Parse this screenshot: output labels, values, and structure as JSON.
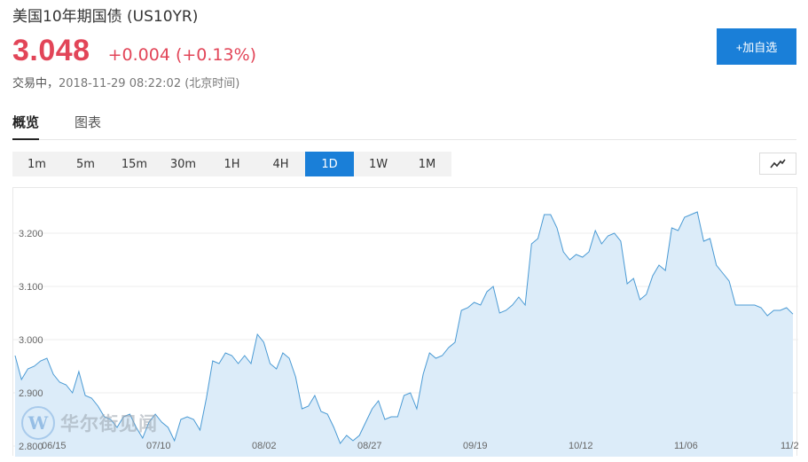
{
  "header": {
    "title": "美国10年期国债  (US10YR)",
    "price": "3.048",
    "change": "+0.004 (+0.13%)",
    "status": "交易中，",
    "timestamp": "2018-11-29 08:22:02 (北京时间)",
    "add_button": "+加自选"
  },
  "tabs": [
    {
      "label": "概览",
      "active": true
    },
    {
      "label": "图表",
      "active": false
    }
  ],
  "periods": [
    "1m",
    "5m",
    "15m",
    "30m",
    "1H",
    "4H",
    "1D",
    "1W",
    "1M"
  ],
  "active_period": "1D",
  "watermark": {
    "text": "华尔街见闻",
    "logo_letter": "W"
  },
  "colors": {
    "accent": "#1a7fd8",
    "price_up": "#e24558",
    "line": "#4a9ad4",
    "area": "#dcecf9"
  },
  "chart_data": {
    "type": "area",
    "x_tick_labels": [
      "06/15",
      "07/10",
      "08/02",
      "08/27",
      "09/19",
      "10/12",
      "11/06",
      "11/2"
    ],
    "y_tick_labels": [
      "3.200",
      "3.100",
      "3.000",
      "2.900",
      "2.800"
    ],
    "y_ticks": [
      3.2,
      3.1,
      3.0,
      2.9,
      2.8
    ],
    "ylim": [
      2.78,
      3.285
    ],
    "grid": true,
    "values": [
      2.97,
      2.925,
      2.945,
      2.95,
      2.96,
      2.965,
      2.935,
      2.92,
      2.915,
      2.9,
      2.94,
      2.895,
      2.89,
      2.875,
      2.855,
      2.85,
      2.835,
      2.855,
      2.86,
      2.835,
      2.815,
      2.845,
      2.86,
      2.845,
      2.835,
      2.81,
      2.85,
      2.855,
      2.85,
      2.83,
      2.89,
      2.96,
      2.955,
      2.975,
      2.97,
      2.955,
      2.97,
      2.955,
      3.01,
      2.995,
      2.955,
      2.945,
      2.975,
      2.965,
      2.93,
      2.87,
      2.875,
      2.895,
      2.865,
      2.86,
      2.835,
      2.805,
      2.82,
      2.81,
      2.82,
      2.845,
      2.87,
      2.885,
      2.85,
      2.855,
      2.855,
      2.895,
      2.9,
      2.87,
      2.935,
      2.975,
      2.965,
      2.97,
      2.985,
      2.995,
      3.055,
      3.06,
      3.07,
      3.065,
      3.09,
      3.1,
      3.05,
      3.055,
      3.065,
      3.08,
      3.065,
      3.18,
      3.19,
      3.235,
      3.235,
      3.21,
      3.165,
      3.15,
      3.16,
      3.155,
      3.165,
      3.205,
      3.18,
      3.195,
      3.2,
      3.185,
      3.105,
      3.115,
      3.075,
      3.085,
      3.12,
      3.14,
      3.13,
      3.21,
      3.205,
      3.23,
      3.235,
      3.24,
      3.185,
      3.19,
      3.14,
      3.125,
      3.11,
      3.065,
      3.065,
      3.065,
      3.065,
      3.06,
      3.045,
      3.055,
      3.055,
      3.06,
      3.048
    ]
  }
}
